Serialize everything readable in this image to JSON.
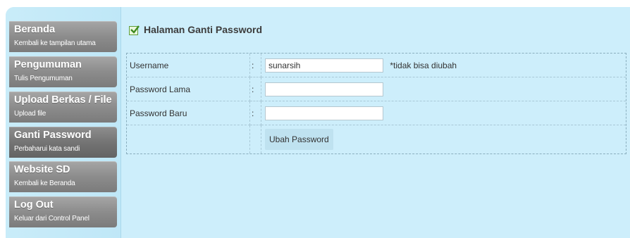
{
  "sidebar": {
    "items": [
      {
        "title": "Beranda",
        "subtitle": "Kembali ke tampilan utama"
      },
      {
        "title": "Pengumuman",
        "subtitle": "Tulis Pengumuman"
      },
      {
        "title": "Upload Berkas / File",
        "subtitle": "Upload file"
      },
      {
        "title": "Ganti Password",
        "subtitle": "Perbaharui kata sandi"
      },
      {
        "title": "Website SD",
        "subtitle": "Kembali ke Beranda"
      },
      {
        "title": "Log Out",
        "subtitle": "Keluar dari Control Panel"
      }
    ]
  },
  "main": {
    "heading": "Halaman Ganti Password",
    "form": {
      "username_label": "Username",
      "username_value": "sunarsih",
      "username_note": "*tidak bisa diubah",
      "old_password_label": "Password Lama",
      "old_password_value": "",
      "new_password_label": "Password Baru",
      "new_password_value": "",
      "colon": ":",
      "submit_label": "Ubah Password"
    }
  }
}
